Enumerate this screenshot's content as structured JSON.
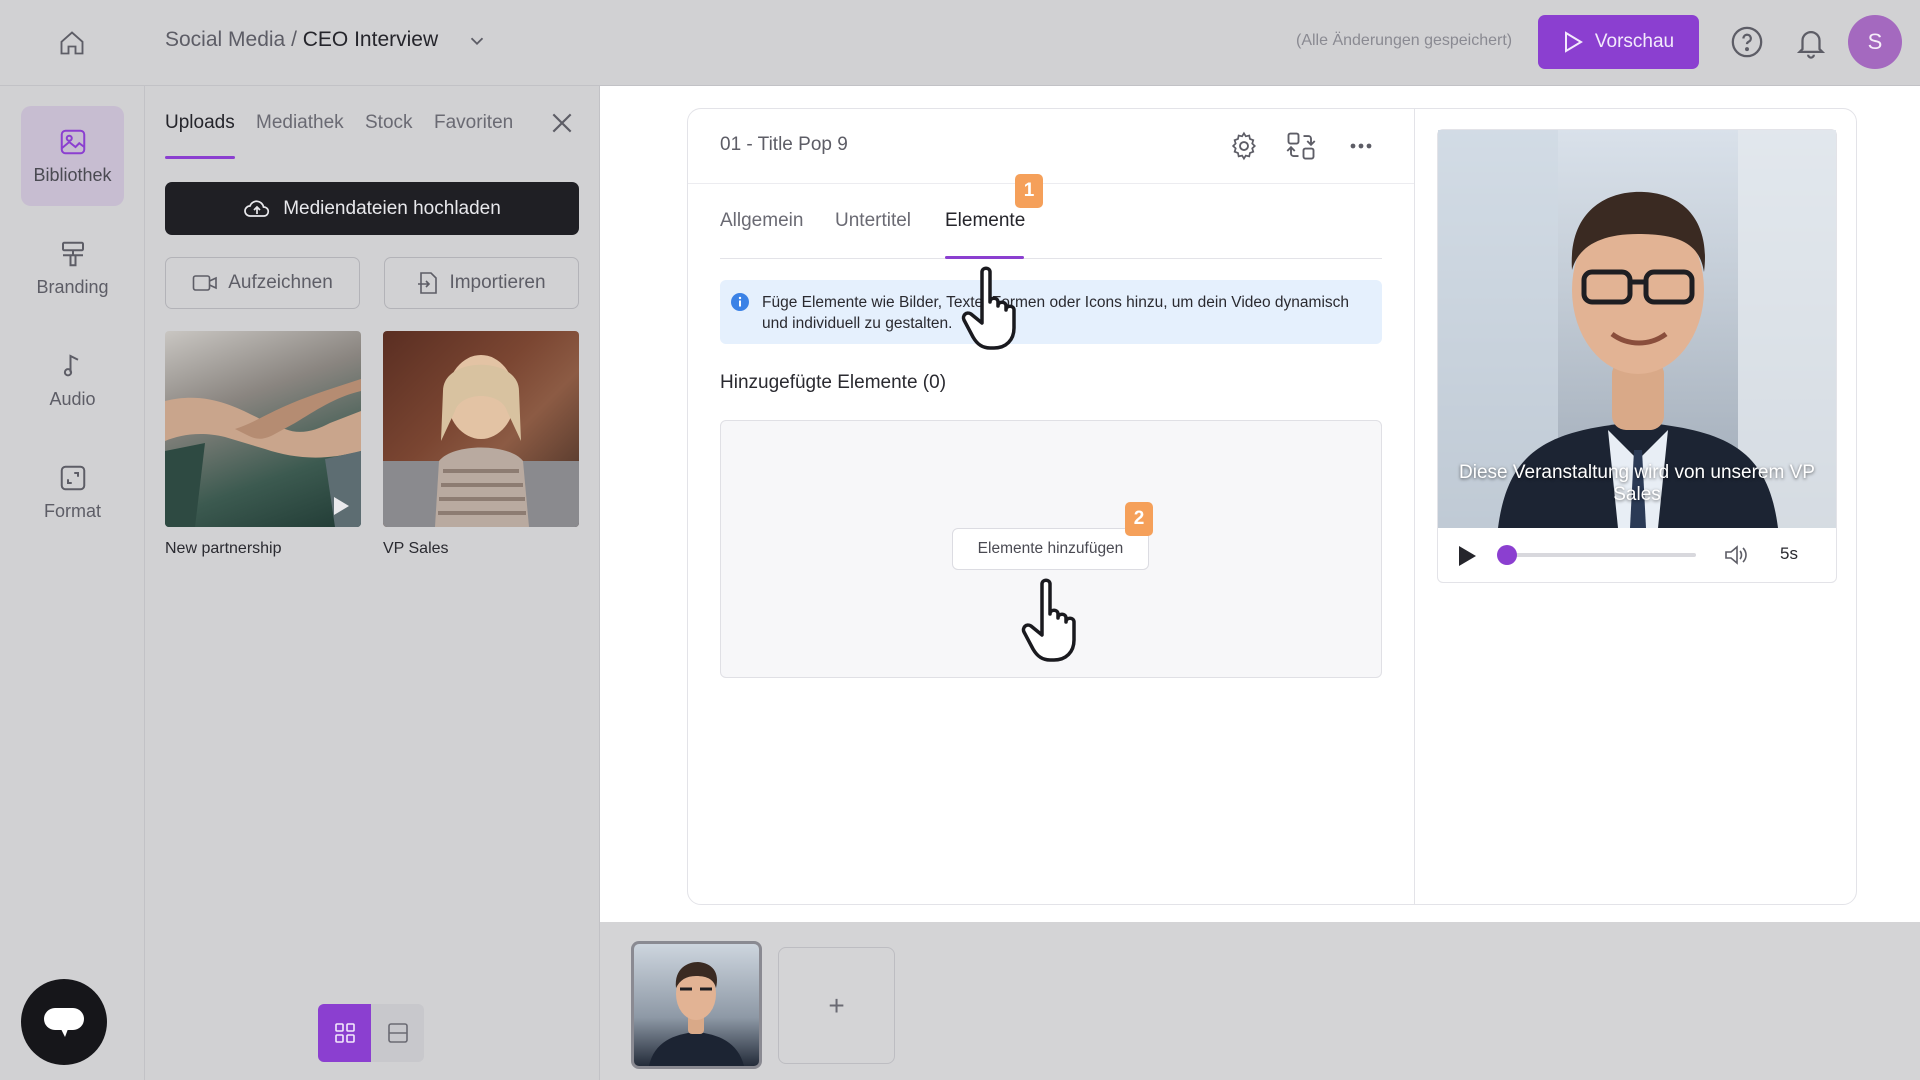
{
  "topbar": {
    "breadcrumb_parent": "Social Media",
    "breadcrumb_separator": " / ",
    "breadcrumb_current": "CEO Interview",
    "saved_status": "(Alle Änderungen gespeichert)",
    "preview_label": "Vorschau",
    "avatar_initial": "S"
  },
  "nav": {
    "items": [
      {
        "label": "Bibliothek",
        "icon": "image-icon",
        "active": true
      },
      {
        "label": "Branding",
        "icon": "paint-roller-icon"
      },
      {
        "label": "Audio",
        "icon": "music-note-icon"
      },
      {
        "label": "Format",
        "icon": "resize-icon"
      }
    ]
  },
  "library": {
    "tabs": [
      "Uploads",
      "Mediathek",
      "Stock",
      "Favoriten"
    ],
    "active_tab": "Uploads",
    "upload_label": "Mediendateien hochladen",
    "record_label": "Aufzeichnen",
    "import_label": "Importieren",
    "media": [
      {
        "caption": "New partnership",
        "type": "video"
      },
      {
        "caption": "VP Sales",
        "type": "image"
      }
    ]
  },
  "editor": {
    "card_title": "01 - Title Pop 9",
    "tabs": [
      "Allgemein",
      "Untertitel",
      "Elemente"
    ],
    "active_tab": "Elemente",
    "info_text": "Füge Elemente wie Bilder, Texte, Formen oder Icons hinzu, um dein Video dynamisch und individuell zu gestalten.",
    "added_title": "Hinzugefügte Elemente (0)",
    "add_button": "Elemente hinzufügen",
    "step_badges": [
      "1",
      "2"
    ]
  },
  "preview": {
    "subtitle": "Diese Veranstaltung wird von unserem VP Sales",
    "duration": "5s",
    "progress": 0
  },
  "timeline": {
    "add_scene": "+"
  },
  "colors": {
    "accent": "#8b3fd0",
    "badge": "#f5a05a",
    "info_bg": "#e5f0fd"
  }
}
